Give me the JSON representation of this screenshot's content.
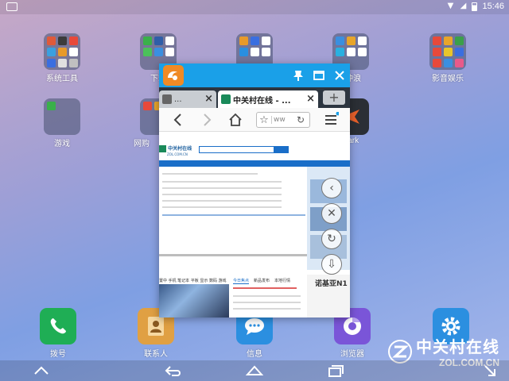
{
  "status_bar": {
    "clock": "15:46"
  },
  "desktop": {
    "folders": [
      {
        "label": "系统工具"
      },
      {
        "label": "下载"
      },
      {
        "label": ""
      },
      {
        "label": "冲浪"
      },
      {
        "label": "影音娱乐"
      },
      {
        "label": "游戏"
      },
      {
        "label": "网购"
      },
      {
        "label": "Mark"
      }
    ]
  },
  "dock": [
    {
      "label": "拨号",
      "icon": "phone-icon",
      "color": "#1fae55"
    },
    {
      "label": "联系人",
      "icon": "contacts-icon",
      "color": "#e0a043"
    },
    {
      "label": "信息",
      "icon": "message-icon",
      "color": "#2b8fe0"
    },
    {
      "label": "浏览器",
      "icon": "browser-icon",
      "color": "#7a55d8"
    },
    {
      "label": "",
      "icon": "settings-icon",
      "color": "#2b8fe0"
    }
  ],
  "browser": {
    "app": "uc-browser",
    "tabs": [
      {
        "title": "...",
        "active": false
      },
      {
        "title": "中关村在线 - ...",
        "active": true
      }
    ],
    "new_tab_label": "+",
    "url_text": "ww",
    "page": {
      "logo_text": "中关村在线",
      "logo_sub": "ZOL.COM.CN",
      "promo_title": "诺基亚N1",
      "nav_links": "置中 手机 笔记本 平板 显示 数码 游戏",
      "news_tabs": [
        "今日焦点",
        "新品发布",
        "本地行情"
      ]
    }
  },
  "watermark": {
    "brand": "中关村在线",
    "url": "ZOL.COM.CN"
  }
}
